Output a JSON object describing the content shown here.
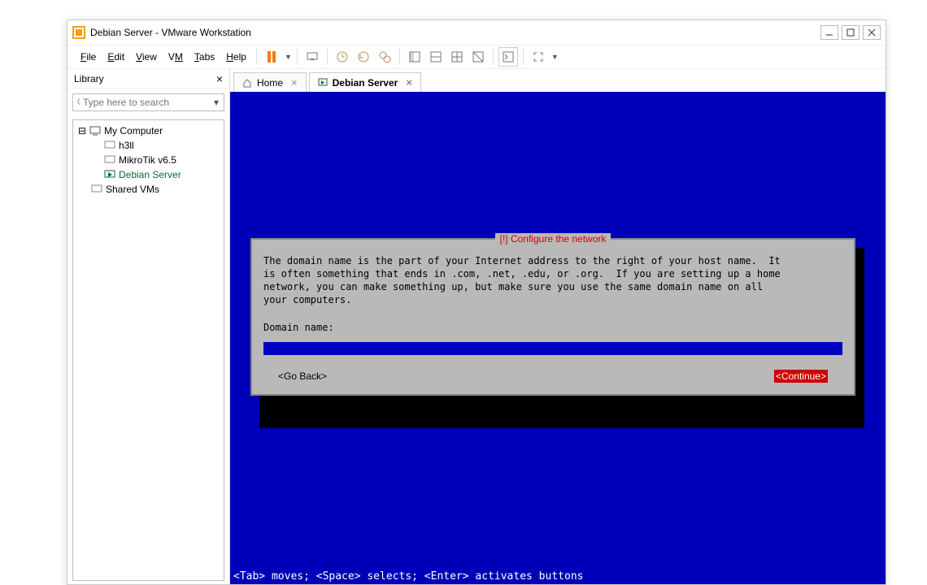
{
  "title": "Debian Server - VMware Workstation",
  "menu": {
    "file": "File",
    "edit": "Edit",
    "view": "View",
    "vm": "VM",
    "tabs": "Tabs",
    "help": "Help"
  },
  "library": {
    "header": "Library",
    "search_placeholder": "Type here to search",
    "root": "My Computer",
    "children": [
      "h3ll",
      "MikroTik v6.5",
      "Debian Server"
    ],
    "shared": "Shared VMs"
  },
  "tabs": {
    "home": "Home",
    "active": "Debian Server"
  },
  "dialog": {
    "title": "[!] Configure the network",
    "body": "The domain name is the part of your Internet address to the right of your host name.  It\nis often something that ends in .com, .net, .edu, or .org.  If you are setting up a home\nnetwork, you can make something up, but make sure you use the same domain name on all\nyour computers.",
    "label": "Domain name:",
    "go_back": "<Go Back>",
    "continue": "<Continue>"
  },
  "helpline": "<Tab> moves; <Space> selects; <Enter> activates buttons",
  "icons": {
    "pause": "pause-icon",
    "search": "search-icon"
  }
}
